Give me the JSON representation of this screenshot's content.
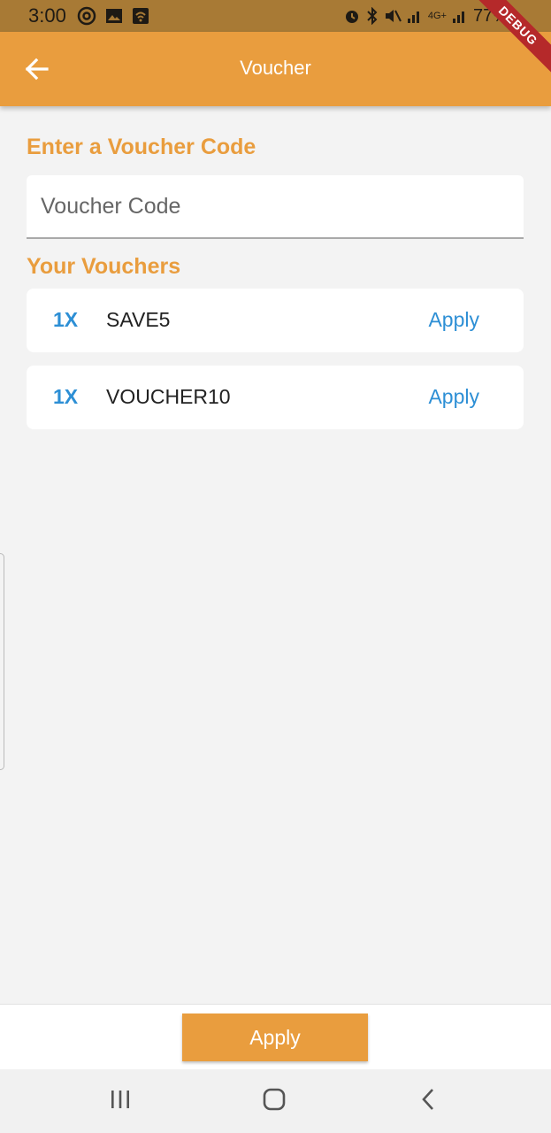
{
  "status_bar": {
    "time": "3:00",
    "battery": "77%",
    "network": "4G+"
  },
  "app_bar": {
    "title": "Voucher",
    "debug_label": "DEBUG"
  },
  "enter_section": {
    "label": "Enter a Voucher Code",
    "input_placeholder": "Voucher Code",
    "input_value": ""
  },
  "vouchers_section": {
    "label": "Your Vouchers",
    "items": [
      {
        "qty": "1X",
        "code": "SAVE5",
        "action": "Apply"
      },
      {
        "qty": "1X",
        "code": "VOUCHER10",
        "action": "Apply"
      }
    ]
  },
  "footer": {
    "apply_label": "Apply"
  },
  "colors": {
    "accent": "#e99d3e",
    "link": "#2d8fd5",
    "background": "#f3f3f3"
  },
  "nav_bar": {
    "icons": [
      "recents-icon",
      "home-icon",
      "back-icon"
    ]
  }
}
